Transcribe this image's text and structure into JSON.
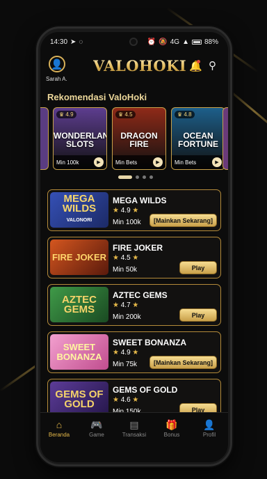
{
  "statusbar": {
    "time": "14:30",
    "network": "4G",
    "battery": "88%"
  },
  "header": {
    "username": "Sarah A.",
    "logo": "VALOHOKI"
  },
  "section_title": "Rekomendasi ValoHoki",
  "carousel": [
    {
      "title": "WONDERLAND SLOTS",
      "rating": "4.9",
      "min": "Min 100k",
      "bg": "#5d3d8f"
    },
    {
      "title": "DRAGON FIRE",
      "rating": "4.5",
      "min": "Min Bets",
      "bg": "#8f2a18"
    },
    {
      "title": "OCEAN FORTUNE",
      "rating": "4.8",
      "min": "Min Bets",
      "bg": "#1d5f8a"
    }
  ],
  "games": [
    {
      "title": "MEGA WILDS",
      "rating": "4.9",
      "min": "Min 100k",
      "button": "[Mainkan Sekarang]",
      "thumb_text": "MEGA WILDS",
      "thumb_sub": "VALONORI",
      "thumb_bg": "#2a3f8f"
    },
    {
      "title": "FIRE JOKER",
      "rating": "4.5",
      "min": "Min 50k",
      "button": "Play",
      "thumb_text": "FIRE JOKER",
      "thumb_sub": "",
      "thumb_bg": "#a23a1c"
    },
    {
      "title": "AZTEC GEMS",
      "rating": "4.7",
      "min": "Min 200k",
      "button": "Play",
      "thumb_text": "AZTEC GEMS",
      "thumb_sub": "",
      "thumb_bg": "#2f7a3a"
    },
    {
      "title": "SWEET BONANZA",
      "rating": "4.9",
      "min": "Min 75k",
      "button": "[Mainkan Sekarang]",
      "thumb_text": "SWEET BONANZA",
      "thumb_sub": "",
      "thumb_bg": "#d86aa8"
    },
    {
      "title": "GEMS OF GOLD",
      "rating": "4.6",
      "min": "Min 150k",
      "button": "Play",
      "thumb_text": "GEMS OF GOLD",
      "thumb_sub": "",
      "thumb_bg": "#4a2f7a"
    }
  ],
  "nav": [
    {
      "label": "Beranda",
      "icon": "home-icon",
      "active": true
    },
    {
      "label": "Game",
      "icon": "gamepad-icon",
      "active": false
    },
    {
      "label": "Transaksi",
      "icon": "receipt-icon",
      "active": false
    },
    {
      "label": "Bonus",
      "icon": "gift-icon",
      "active": false
    },
    {
      "label": "Profil",
      "icon": "user-icon",
      "active": false
    }
  ],
  "colors": {
    "accent": "#e6b94a",
    "border_gold": "#b48b3a",
    "background": "#0c0c0c"
  }
}
